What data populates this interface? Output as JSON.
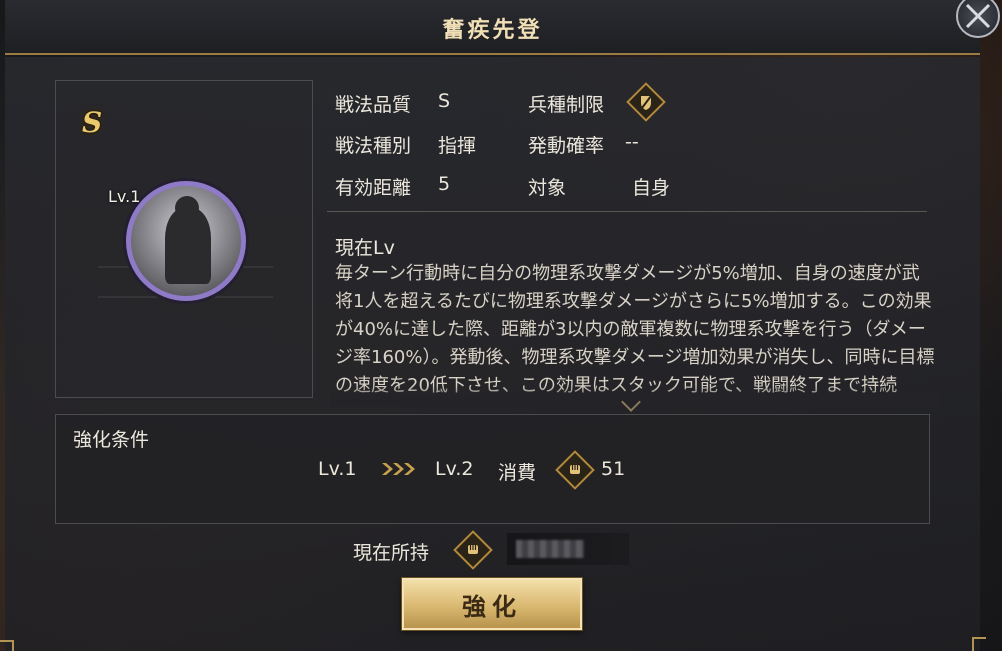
{
  "header": {
    "title": "奮疾先登"
  },
  "skill": {
    "grade_badge": "S",
    "level_badge": "Lv.1"
  },
  "info": {
    "quality_label": "戦法品質",
    "quality_value": "S",
    "restriction_label": "兵種制限",
    "type_label": "戦法種別",
    "type_value": "指揮",
    "rate_label": "発動確率",
    "rate_value": "--",
    "range_label": "有効距離",
    "range_value": "5",
    "target_label": "対象",
    "target_value": "自身"
  },
  "description": {
    "title": "現在Lv",
    "body": "毎ターン行動時に自分の物理系攻撃ダメージが5%増加、自身の速度が武将1人を超えるたびに物理系攻撃ダメージがさらに5%増加する。この効果が40%に達した際、距離が3以内の敵軍複数に物理系攻撃を行う（ダメージ率160%）。発動後、物理系攻撃ダメージ増加効果が消失し、同時に目標の速度を20低下させ、この効果はスタック可能で、戦闘終了まで持続"
  },
  "upgrade": {
    "title": "強化条件",
    "from_level": "Lv.1",
    "to_level": "Lv.2",
    "cost_label": "消費",
    "cost_value": "51"
  },
  "owned": {
    "label": "現在所持"
  },
  "actions": {
    "enhance_label": "強化"
  },
  "colors": {
    "accent_gold": "#c9a04d",
    "frame_purple": "#8e7ac6"
  },
  "icons": {
    "close": "close-icon",
    "restriction": "shield-restriction-icon",
    "arrows": "triple-chevron-right-icon",
    "currency": "fist-token-icon"
  }
}
